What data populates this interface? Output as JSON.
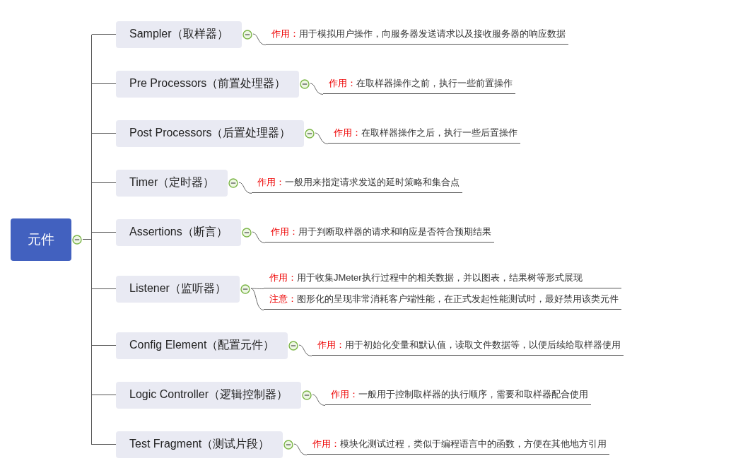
{
  "root": {
    "label": "元件",
    "expanded": true
  },
  "topics": [
    {
      "label": "Sampler（取样器）",
      "expanded": true,
      "notes": [
        {
          "label": "作用：",
          "text": "用于模拟用户操作，向服务器发送请求以及接收服务器的响应数据"
        }
      ]
    },
    {
      "label": "Pre Processors（前置处理器）",
      "expanded": true,
      "notes": [
        {
          "label": "作用：",
          "text": "在取样器操作之前，执行一些前置操作"
        }
      ]
    },
    {
      "label": "Post Processors（后置处理器）",
      "expanded": true,
      "notes": [
        {
          "label": "作用：",
          "text": "在取样器操作之后，执行一些后置操作"
        }
      ]
    },
    {
      "label": "Timer（定时器）",
      "expanded": true,
      "notes": [
        {
          "label": "作用：",
          "text": "一般用来指定请求发送的延时策略和集合点"
        }
      ]
    },
    {
      "label": "Assertions（断言）",
      "expanded": true,
      "notes": [
        {
          "label": "作用：",
          "text": "用于判断取样器的请求和响应是否符合预期结果"
        }
      ]
    },
    {
      "label": "Listener（监听器）",
      "expanded": true,
      "notes": [
        {
          "label": "作用：",
          "text": "用于收集JMeter执行过程中的相关数据，并以图表，结果树等形式展现"
        },
        {
          "label": "注意：",
          "text": "图形化的呈现非常消耗客户端性能，在正式发起性能测试时，最好禁用该类元件"
        }
      ]
    },
    {
      "label": "Config Element（配置元件）",
      "expanded": true,
      "notes": [
        {
          "label": "作用：",
          "text": "用于初始化变量和默认值，读取文件数据等，以便后续给取样器使用"
        }
      ]
    },
    {
      "label": "Logic Controller（逻辑控制器）",
      "expanded": true,
      "notes": [
        {
          "label": "作用：",
          "text": "一般用于控制取样器的执行顺序，需要和取样器配合使用"
        }
      ]
    },
    {
      "label": "Test Fragment（测试片段）",
      "expanded": true,
      "notes": [
        {
          "label": "作用：",
          "text": "模块化测试过程，类似于编程语言中的函数，方便在其他地方引用"
        }
      ]
    }
  ]
}
